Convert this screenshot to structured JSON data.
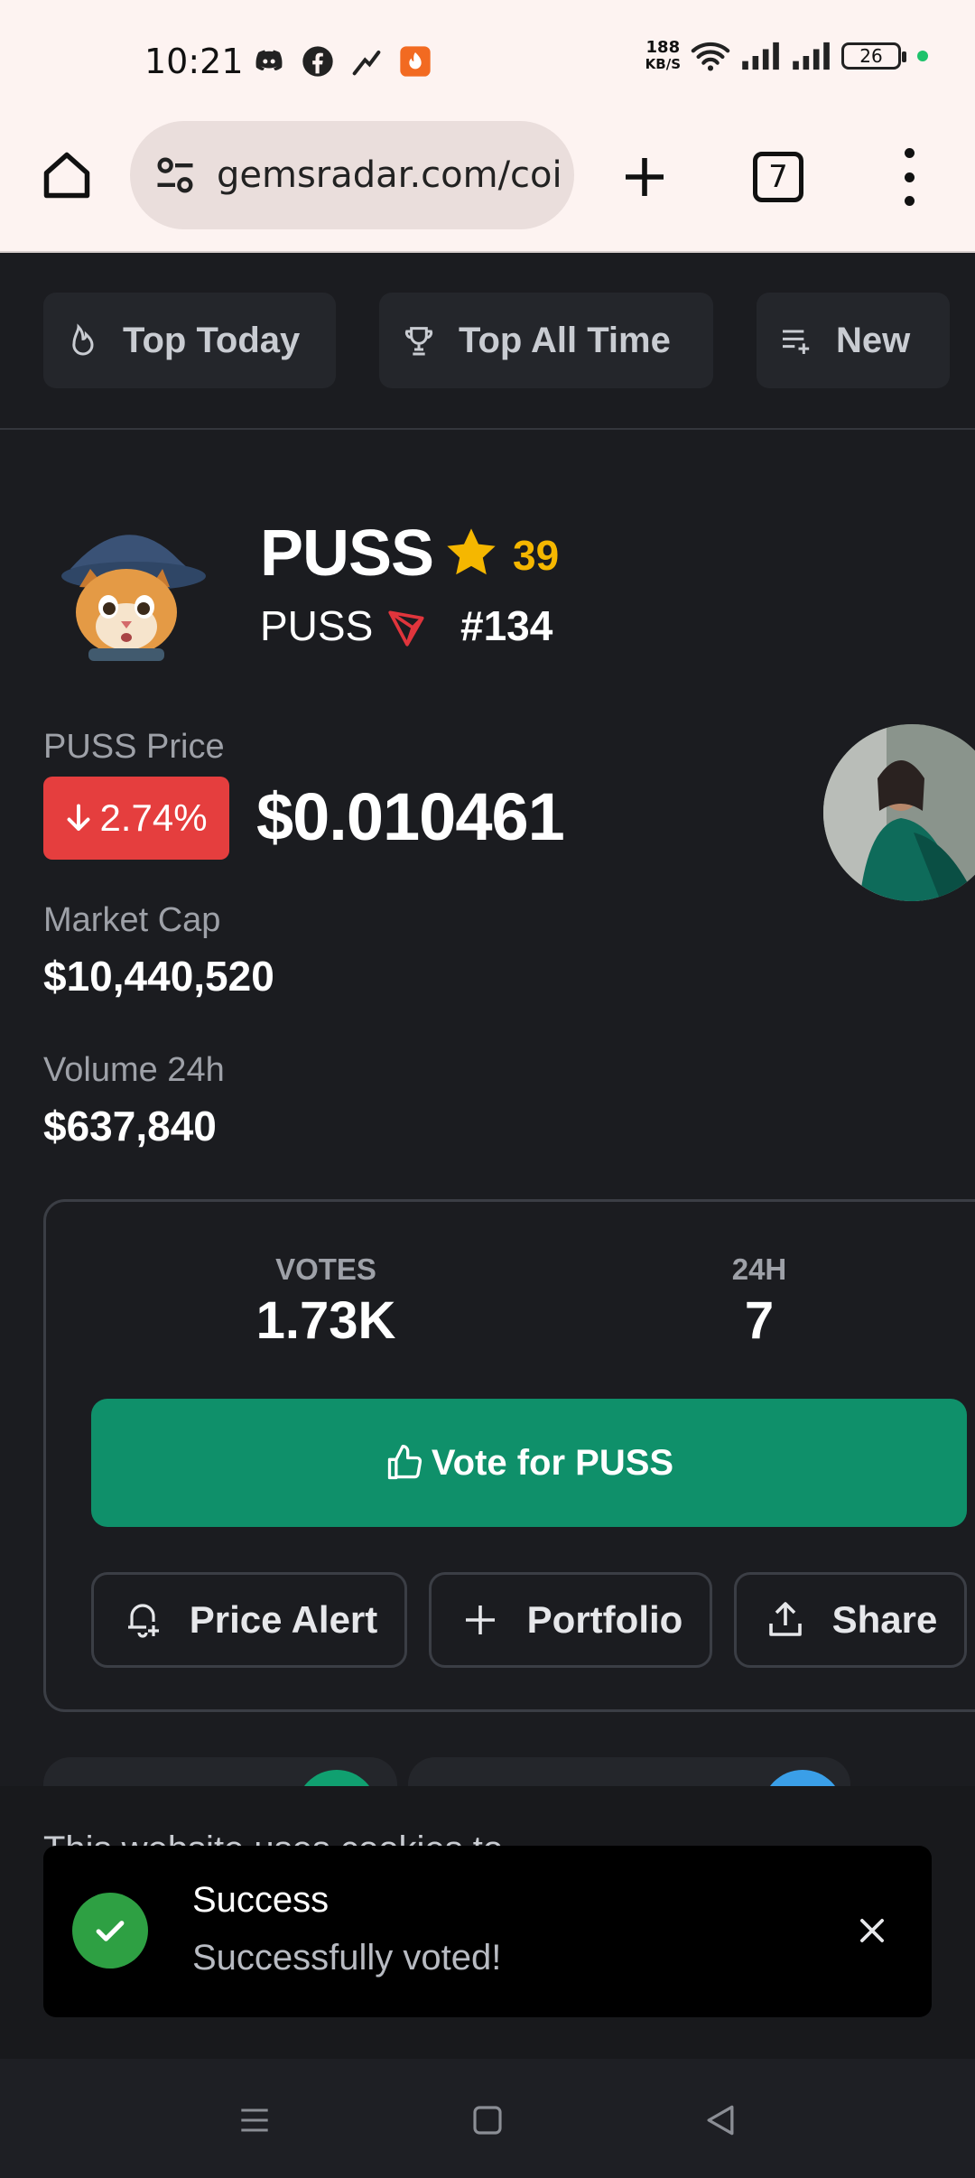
{
  "status_bar": {
    "time": "10:21",
    "net_speed_value": "188",
    "net_speed_unit": "KB/S",
    "battery": "26"
  },
  "browser": {
    "url": "gemsradar.com/coi",
    "tab_count": "7"
  },
  "categories": [
    {
      "label": "Top Today",
      "icon": "flame-icon"
    },
    {
      "label": "Top All Time",
      "icon": "trophy-icon"
    },
    {
      "label": "New",
      "icon": "list-add-icon"
    }
  ],
  "coin": {
    "name": "PUSS",
    "star_count": "39",
    "symbol": "PUSS",
    "rank": "#134",
    "price_label": "PUSS Price",
    "change": "2.74%",
    "price": "$0.010461",
    "market_cap_label": "Market Cap",
    "market_cap": "$10,440,520",
    "volume_label": "Volume 24h",
    "volume": "$637,840"
  },
  "votes": {
    "votes_label": "VOTES",
    "votes_value": "1.73K",
    "h24_label": "24H",
    "h24_value": "7",
    "vote_button": "Vote for PUSS",
    "price_alert": "Price Alert",
    "portfolio": "Portfolio",
    "share": "Share"
  },
  "cookie_text": "This website uses cookies to",
  "toast": {
    "title": "Success",
    "message": "Successfully voted!"
  },
  "colors": {
    "background": "#1b1c20",
    "vote_green": "#0f906a",
    "change_red": "#e53e3e",
    "star_yellow": "#f5b700",
    "success_green": "#2ea043"
  }
}
